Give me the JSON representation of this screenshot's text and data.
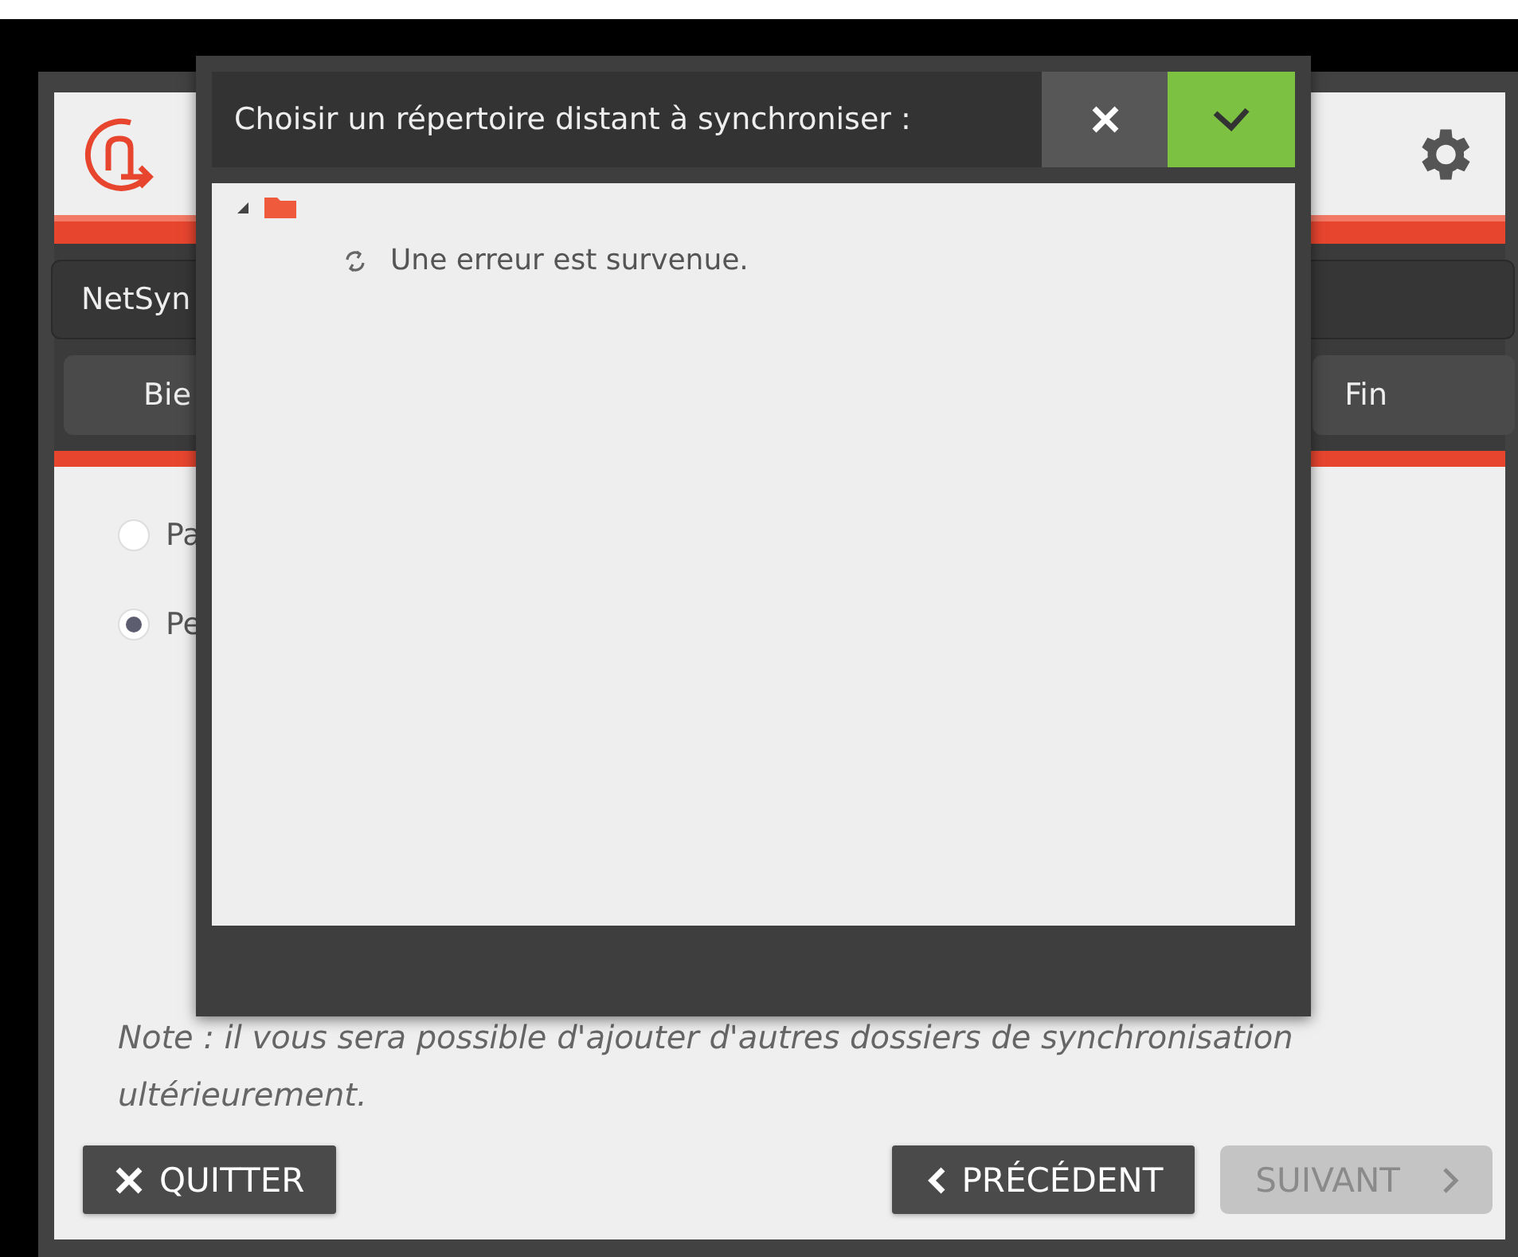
{
  "app": {
    "account_field": {
      "value": "NetSyn"
    },
    "steps": [
      {
        "label": "Bie"
      },
      {
        "label": "Fin"
      }
    ],
    "options": [
      {
        "label": "Pa",
        "selected": false
      },
      {
        "label": "Pe",
        "selected": true
      }
    ],
    "note": "Note : il vous sera possible d'ajouter d'autres dossiers de synchronisation ultérieurement.",
    "buttons": [
      {
        "kind": "quit",
        "label": "QUITTER",
        "disabled": false
      },
      {
        "kind": "previous",
        "label": "PRÉCÉDENT",
        "disabled": false
      },
      {
        "kind": "next",
        "label": "SUIVANT",
        "disabled": true
      }
    ]
  },
  "dialog": {
    "title": "Choisir un répertoire distant à synchroniser :",
    "tree": [
      {
        "expanded": true,
        "children": [
          {
            "kind": "loading",
            "label": "Une erreur est survenue."
          }
        ]
      }
    ]
  }
}
